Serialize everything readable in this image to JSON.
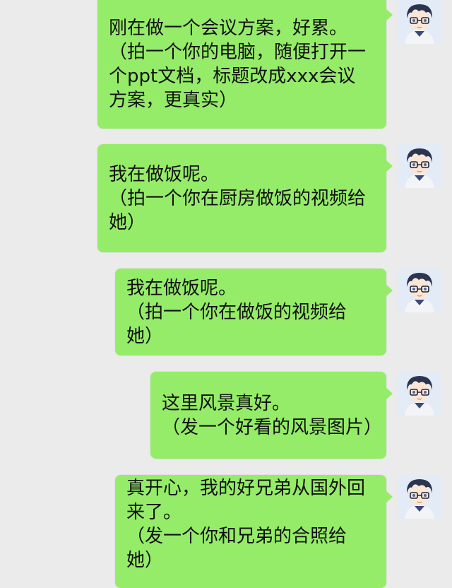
{
  "chat": {
    "messages": [
      {
        "text": "刚在做一个会议方案，好累。\n（拍一个你的电脑，随便打开一个ppt文档，标题改成xxx会议方案，更真实）",
        "avatar_icon": "user-avatar-icon"
      },
      {
        "text": "我在做饭呢。\n（拍一个你在厨房做饭的视频给她）",
        "avatar_icon": "user-avatar-icon"
      },
      {
        "text": "我在做饭呢。\n（拍一个你在做饭的视频给她）",
        "avatar_icon": "user-avatar-icon"
      },
      {
        "text": "这里风景真好。\n（发一个好看的风景图片）",
        "avatar_icon": "user-avatar-icon"
      },
      {
        "text": "真开心，我的好兄弟从国外回来了。\n（发一个你和兄弟的合照给她）",
        "avatar_icon": "user-avatar-icon"
      }
    ],
    "colors": {
      "background": "#ebebeb",
      "bubble": "#95ec69",
      "text": "#111111"
    }
  }
}
